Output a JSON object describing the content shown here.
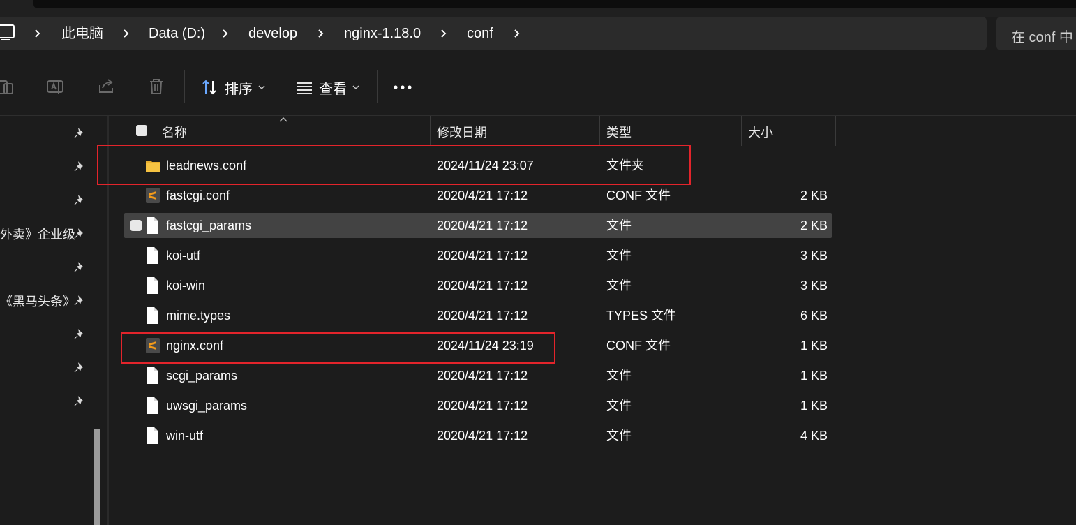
{
  "breadcrumb": {
    "items": [
      "此电脑",
      "Data (D:)",
      "develop",
      "nginx-1.18.0",
      "conf"
    ]
  },
  "search": {
    "placeholder": "在 conf 中"
  },
  "toolbar": {
    "sort_label": "排序",
    "view_label": "查看",
    "more_label": "..."
  },
  "sidebar": {
    "items": [
      {
        "label": ""
      },
      {
        "label": ""
      },
      {
        "label": ""
      },
      {
        "label": "外卖》企业级"
      },
      {
        "label": ""
      },
      {
        "label": "《黑马头条》"
      },
      {
        "label": ""
      },
      {
        "label": ""
      },
      {
        "label": ""
      }
    ]
  },
  "columns": {
    "name": "名称",
    "modified": "修改日期",
    "type": "类型",
    "size": "大小"
  },
  "files": [
    {
      "name": "leadnews.conf",
      "modified": "2024/11/24 23:07",
      "type": "文件夹",
      "size": "",
      "icon": "folder-icon"
    },
    {
      "name": "fastcgi.conf",
      "modified": "2020/4/21 17:12",
      "type": "CONF 文件",
      "size": "2 KB",
      "icon": "sublime-file-icon"
    },
    {
      "name": "fastcgi_params",
      "modified": "2020/4/21 17:12",
      "type": "文件",
      "size": "2 KB",
      "icon": "file-icon"
    },
    {
      "name": "koi-utf",
      "modified": "2020/4/21 17:12",
      "type": "文件",
      "size": "3 KB",
      "icon": "file-icon"
    },
    {
      "name": "koi-win",
      "modified": "2020/4/21 17:12",
      "type": "文件",
      "size": "3 KB",
      "icon": "file-icon"
    },
    {
      "name": "mime.types",
      "modified": "2020/4/21 17:12",
      "type": "TYPES 文件",
      "size": "6 KB",
      "icon": "file-icon"
    },
    {
      "name": "nginx.conf",
      "modified": "2024/11/24 23:19",
      "type": "CONF 文件",
      "size": "1 KB",
      "icon": "sublime-file-icon"
    },
    {
      "name": "scgi_params",
      "modified": "2020/4/21 17:12",
      "type": "文件",
      "size": "1 KB",
      "icon": "file-icon"
    },
    {
      "name": "uwsgi_params",
      "modified": "2020/4/21 17:12",
      "type": "文件",
      "size": "1 KB",
      "icon": "file-icon"
    },
    {
      "name": "win-utf",
      "modified": "2020/4/21 17:12",
      "type": "文件",
      "size": "4 KB",
      "icon": "file-icon"
    }
  ],
  "colors": {
    "highlight": "#e3242b",
    "folder": "#f5c242",
    "sublime": "#f59c1a",
    "hover_row": "#434343"
  }
}
